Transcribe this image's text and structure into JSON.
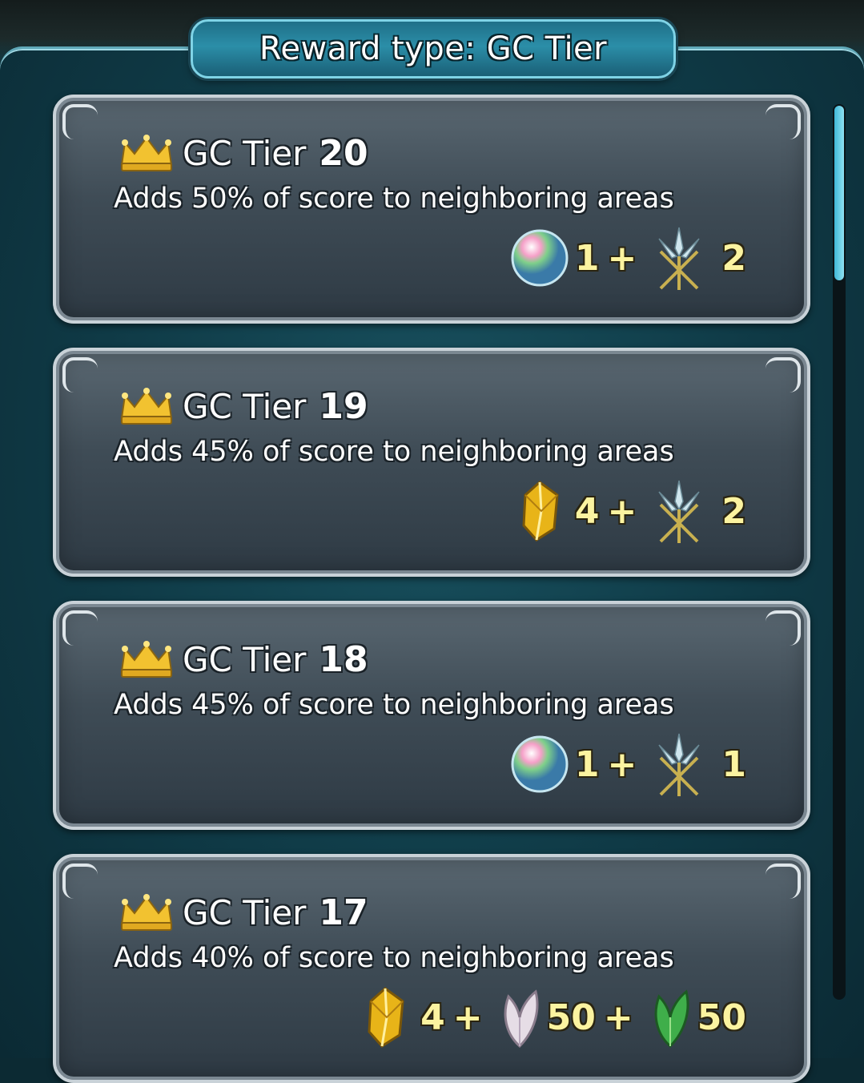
{
  "header": {
    "title": "Reward type: GC Tier"
  },
  "tiers": [
    {
      "label": "GC Tier",
      "number": "20",
      "description": "Adds 50% of score to neighboring areas",
      "rewards": [
        {
          "icon": "orb-icon",
          "qty": "1"
        },
        {
          "icon": "trident-icon",
          "qty": "2"
        }
      ]
    },
    {
      "label": "GC Tier",
      "number": "19",
      "description": "Adds 45% of score to neighboring areas",
      "rewards": [
        {
          "icon": "gold-shard-icon",
          "qty": "4"
        },
        {
          "icon": "trident-icon",
          "qty": "2"
        }
      ]
    },
    {
      "label": "GC Tier",
      "number": "18",
      "description": "Adds 45% of score to neighboring areas",
      "rewards": [
        {
          "icon": "orb-icon",
          "qty": "1"
        },
        {
          "icon": "trident-icon",
          "qty": "1"
        }
      ]
    },
    {
      "label": "GC Tier",
      "number": "17",
      "description": "Adds 40% of score to neighboring areas",
      "rewards": [
        {
          "icon": "gold-shard-icon",
          "qty": "4"
        },
        {
          "icon": "silver-feather-icon",
          "qty": "50"
        },
        {
          "icon": "green-feather-icon",
          "qty": "50"
        }
      ]
    }
  ],
  "separator": "+",
  "colors": {
    "accent": "#7fd3e6",
    "quantity": "#fbf3a0",
    "crown": "#f2c230"
  }
}
